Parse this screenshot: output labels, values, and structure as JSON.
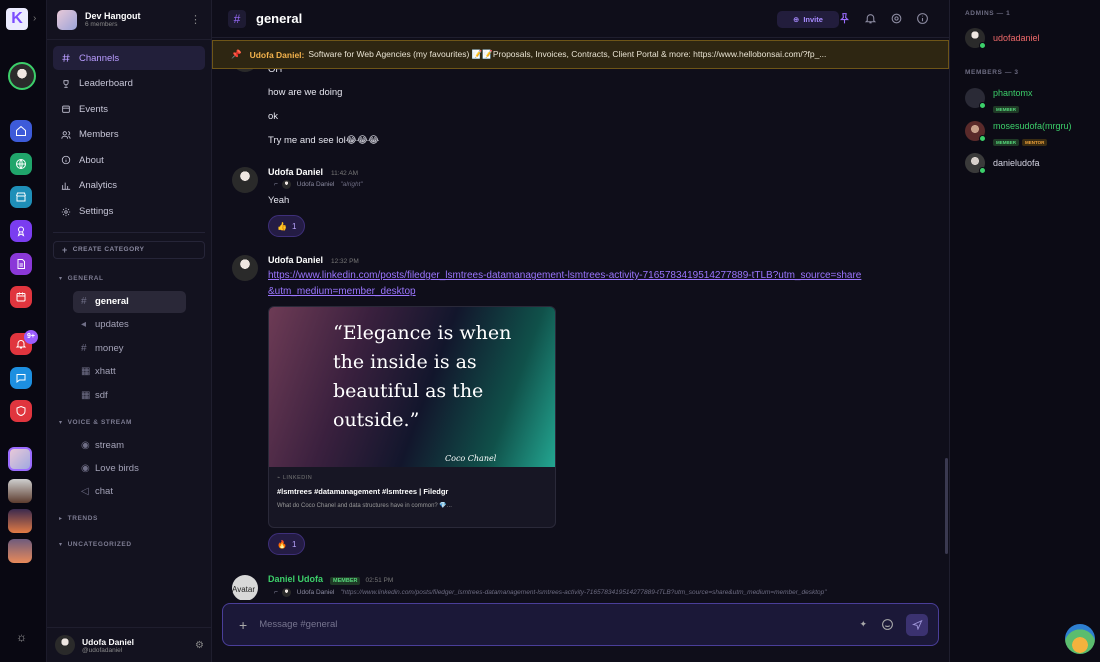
{
  "server": {
    "name": "Dev Hangout",
    "members": "6 members"
  },
  "nav": [
    {
      "label": "Channels"
    },
    {
      "label": "Leaderboard"
    },
    {
      "label": "Events"
    },
    {
      "label": "Members"
    },
    {
      "label": "About"
    },
    {
      "label": "Analytics"
    },
    {
      "label": "Settings"
    }
  ],
  "create_category": "CREATE CATEGORY",
  "categories": {
    "general": "GENERAL",
    "voice": "VOICE & STREAM",
    "trends": "TRENDS",
    "uncategorized": "UNCATEGORIZED"
  },
  "channels": [
    "general",
    "updates",
    "money",
    "xhatt",
    "sdf"
  ],
  "voice_channels": [
    "stream",
    "Love birds",
    "chat"
  ],
  "notification_badge": "9+",
  "current_user": {
    "name": "Udofa Daniel",
    "handle": "@udofadaniel"
  },
  "header": {
    "channel": "general",
    "invite": "Invite"
  },
  "pinned": {
    "author": "Udofa Daniel:",
    "text": "Software for Web Agencies (my favourites) 📝📝Proposals, Invoices, Contracts, Client Portal & more: https://www.hellobonsai.com/?fp_..."
  },
  "messages": {
    "top_partial": "OH",
    "line1": "how are we doing",
    "line2": "ok",
    "line3": "Try me and see lol😂😂😂",
    "msg2": {
      "author": "Udofa Daniel",
      "time": "11:42 AM",
      "reply_author": "Udofa Daniel",
      "reply_text": "\"alright\"",
      "text": "Yeah",
      "reaction": "👍",
      "reaction_count": "1"
    },
    "msg3": {
      "author": "Udofa Daniel",
      "time": "12:32 PM",
      "link": "https://www.linkedin.com/posts/filedger_lsmtrees-datamanagement-lsmtrees-activity-7165783419514277889-tTLB?utm_source=share&utm_medium=member_desktop",
      "embed_quote": "“Elegance is when the inside is as beautiful as the outside.”",
      "embed_author": "Coco Chanel",
      "embed_source": "LINKEDIN",
      "embed_title": "#lsmtrees #datamanagement #lsmtrees | Filedgr",
      "embed_desc": "What do Coco Chanel and data structures have in common? 💎...",
      "reaction": "🔥",
      "reaction_count": "1"
    },
    "msg4": {
      "author": "Daniel Udofa",
      "role": "MEMBER",
      "time": "02:51 PM",
      "avatar_alt": "Avatar",
      "reply_author": "Udofa Daniel",
      "reply_text": "\"https://www.linkedin.com/posts/filedger_lsmtrees-datamanagement-lsmtrees-activity-7165783419514277889-tTLB?utm_source=share&utm_medium=member_desktop\""
    }
  },
  "input": {
    "placeholder": "Message #general"
  },
  "right": {
    "admins_head": "ADMINS — 1",
    "members_head": "MEMBERS — 3",
    "admins": [
      {
        "name": "udofadaniel",
        "color": "#f06a6a"
      }
    ],
    "members": [
      {
        "name": "phantomx",
        "color": "#3ccf6a",
        "tags": [
          "MEMBER"
        ]
      },
      {
        "name": "mosesudofa(mrgru)",
        "color": "#3ccf6a",
        "tags": [
          "MEMBER",
          "MENTOR"
        ]
      },
      {
        "name": "danieludofa",
        "color": "#d6d6e4",
        "tags": []
      }
    ]
  },
  "colors": {
    "accent": "#9b6cff",
    "pin_border": "#6e5518",
    "online": "#3ccf6a"
  }
}
